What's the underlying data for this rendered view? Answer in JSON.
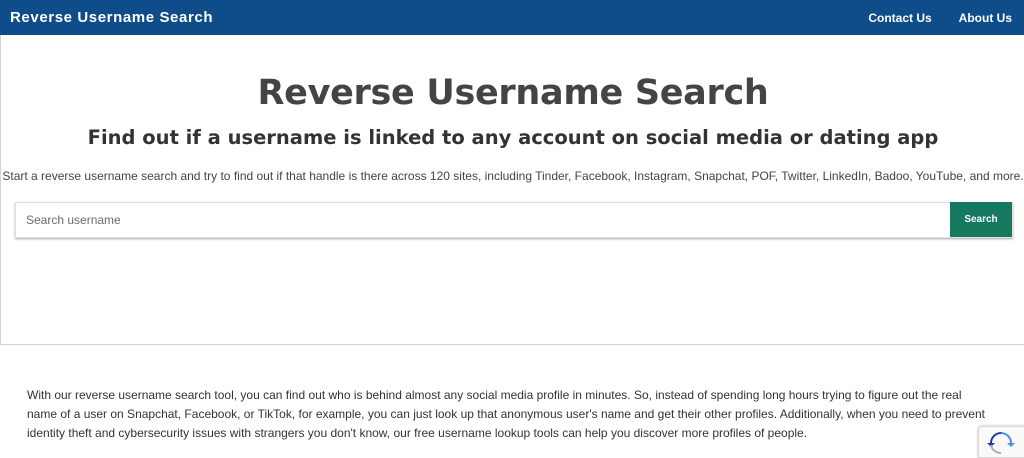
{
  "header": {
    "brand": "Reverse Username Search",
    "nav": [
      {
        "label": "Contact Us"
      },
      {
        "label": "About Us"
      }
    ]
  },
  "hero": {
    "title": "Reverse Username Search",
    "subtitle": "Find out if a username is linked to any account on social media or dating app",
    "lead": "Start a reverse username search and try to find out if that handle is there across 120 sites, including Tinder, Facebook, Instagram, Snapchat, POF, Twitter, LinkedIn, Badoo, YouTube, and more."
  },
  "search": {
    "placeholder": "Search username",
    "value": "",
    "button_label": "Search"
  },
  "content": {
    "paragraph": "With our reverse username search tool, you can find out who is behind almost any social media profile in minutes. So, instead of spending long hours trying to figure out the real name of a user on Snapchat, Facebook, or TikTok, for example, you can just look up that anonymous user's name and get their other profiles. Additionally, when you need to prevent identity theft and cybersecurity issues with strangers you don't know, our free username lookup tools can help you discover more profiles of people."
  },
  "colors": {
    "header_bg": "#0f4c8a",
    "search_button_bg": "#14795f"
  },
  "icons": {
    "recaptcha": "recaptcha-icon"
  }
}
